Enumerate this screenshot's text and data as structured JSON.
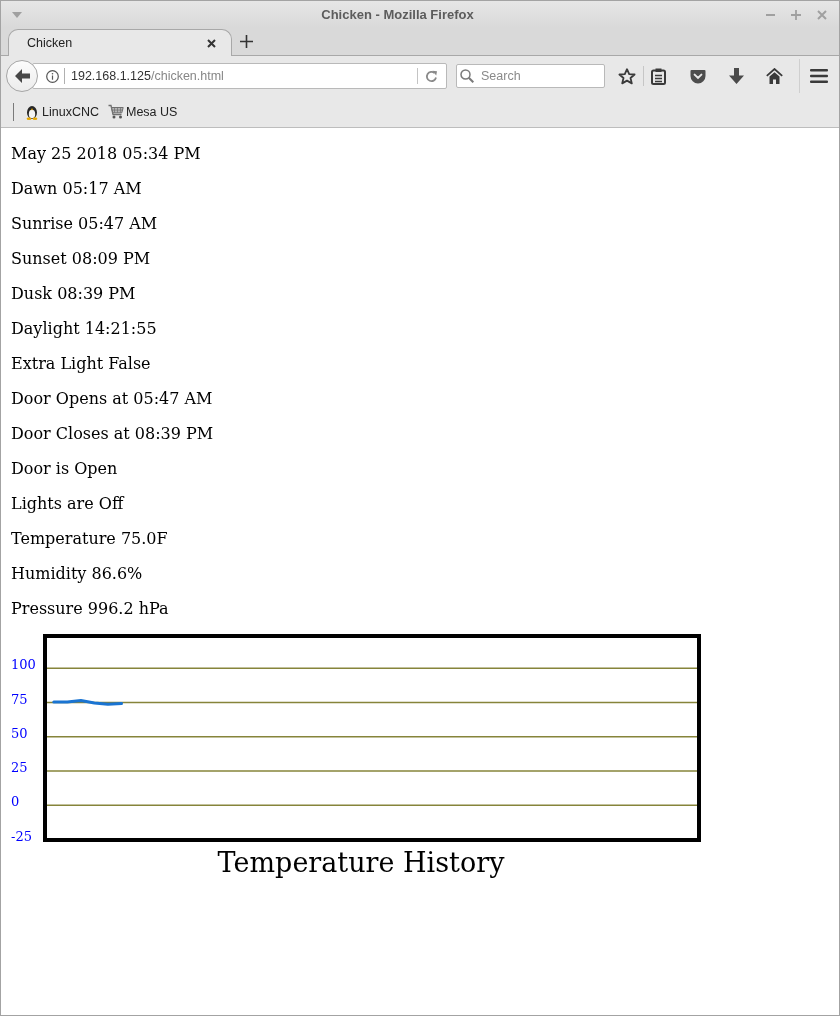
{
  "window": {
    "title": "Chicken - Mozilla Firefox"
  },
  "tabs": [
    {
      "label": "Chicken",
      "selected": true
    }
  ],
  "address_bar": {
    "host": "192.168.1.125",
    "path": "/chicken.html"
  },
  "search": {
    "placeholder": "Search"
  },
  "bookmarks": [
    {
      "label": "LinuxCNC"
    },
    {
      "label": "Mesa US"
    }
  ],
  "page": {
    "lines": [
      "May 25 2018 05:34 PM",
      "Dawn 05:17 AM",
      "Sunrise 05:47 AM",
      "Sunset 08:09 PM",
      "Dusk 08:39 PM",
      "Daylight 14:21:55",
      "Extra Light False",
      "Door Opens at 05:47 AM",
      "Door Closes at 08:39 PM",
      "Door is Open",
      "Lights are Off",
      "Temperature 75.0F",
      "Humidity 86.6%",
      "Pressure 996.2 hPa"
    ],
    "chart": {
      "chart_data": {
        "type": "line",
        "title": "Temperature History",
        "grid": true,
        "categories": [
          null,
          null,
          null,
          null,
          null,
          null,
          null,
          null,
          null,
          null,
          null,
          null,
          null,
          null,
          null,
          null,
          null,
          null,
          null,
          null,
          null,
          null,
          null,
          null,
          null,
          null,
          null,
          null,
          null,
          null,
          null,
          null,
          null,
          null,
          null,
          null,
          null,
          null,
          null,
          null,
          null,
          null,
          null,
          null,
          null,
          null,
          null,
          null
        ],
        "ylim": [
          -25,
          125
        ],
        "yticks": [
          -25,
          0,
          25,
          50,
          75,
          100
        ],
        "series": [
          {
            "color": "#1a74d2",
            "values": [
              75.4,
              75.4,
              76.4,
              74.7,
              73.7,
              74.2,
              null,
              null,
              null,
              null,
              null,
              null,
              null,
              null,
              null,
              null,
              null,
              null,
              null,
              null,
              null,
              null,
              null,
              null,
              null,
              null,
              null,
              null,
              null,
              null,
              null,
              null,
              null,
              null,
              null,
              null,
              null,
              null,
              null,
              null,
              null,
              null,
              null,
              null,
              null,
              null,
              null,
              null
            ]
          }
        ]
      }
    }
  }
}
